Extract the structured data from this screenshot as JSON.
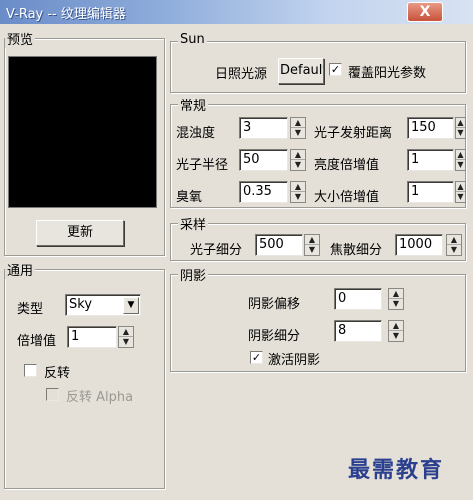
{
  "window": {
    "title": "V-Ray -- 纹理编辑器",
    "close_label": "X"
  },
  "preview": {
    "label": "预览",
    "update_button": "更新"
  },
  "general": {
    "label": "通用",
    "type_label": "类型",
    "type_value": "Sky",
    "multiplier_label": "倍增值",
    "multiplier_value": "1",
    "invert_label": "反转",
    "invert_checked": false,
    "invert_alpha_label": "反转 Alpha",
    "invert_alpha_checked": false
  },
  "sun": {
    "label": "Sun",
    "sun_light_label": "日照光源",
    "sun_light_value": "Default",
    "override_checked": true,
    "override_label": "覆盖阳光参数"
  },
  "params": {
    "label": "常规",
    "turbidity_label": "混浊度",
    "turbidity_value": "3",
    "photon_radius_label": "光子半径",
    "photon_radius_value": "50",
    "ozone_label": "臭氧",
    "ozone_value": "0.35",
    "photon_emit_radius_label": "光子发射距离",
    "photon_emit_radius_value": "150",
    "intensity_mult_label": "亮度倍增值",
    "intensity_mult_value": "1",
    "size_mult_label": "大小倍增值",
    "size_mult_value": "1"
  },
  "sampling": {
    "label": "采样",
    "photon_subdivs_label": "光子细分",
    "photon_subdivs_value": "500",
    "caustic_subdivs_label": "焦散细分",
    "caustic_subdivs_value": "1000"
  },
  "shadows": {
    "label": "阴影",
    "bias_label": "阴影偏移",
    "bias_value": "0",
    "subdivs_label": "阴影细分",
    "subdivs_value": "8",
    "enable_checked": true,
    "enable_label": "激活阴影"
  },
  "watermark": "最需教育"
}
